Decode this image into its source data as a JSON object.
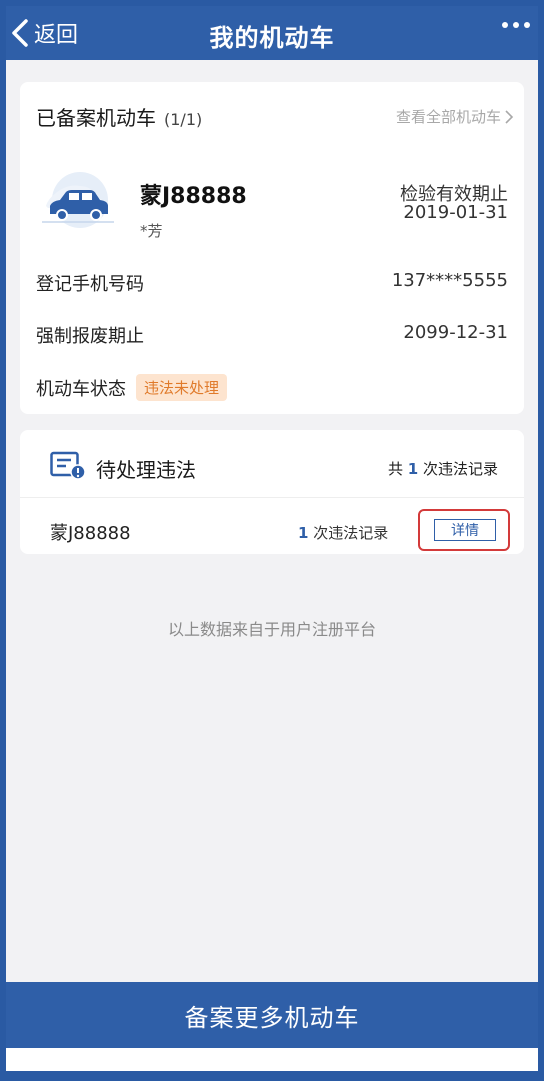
{
  "navbar": {
    "back_label": "返回",
    "title": "我的机动车",
    "more_icon": "more-icon"
  },
  "vehicle_card": {
    "title": "已备案机动车",
    "count": "(1/1)",
    "view_all": "查看全部机动车",
    "plate": "蒙J88888",
    "owner": "*芳",
    "inspection_label": "检验有效期止",
    "inspection_date": "2019-01-31",
    "phone_label": "登记手机号码",
    "phone_value": "137****5555",
    "scrap_label": "强制报废期止",
    "scrap_value": "2099-12-31",
    "status_label": "机动车状态",
    "status_badge": "违法未处理"
  },
  "violation_card": {
    "title": "待处理违法",
    "total_prefix": "共",
    "total_count": "1",
    "total_suffix": "次违法记录",
    "plate": "蒙J88888",
    "item_count": "1",
    "item_suffix": "次违法记录",
    "detail_label": "详情"
  },
  "source_note": "以上数据来自于用户注册平台",
  "bottom_button": "备案更多机动车",
  "colors": {
    "primary": "#2f5fa8",
    "badge_bg": "#fde4cf",
    "badge_text": "#e07a2a",
    "highlight": "#d33a3a"
  }
}
